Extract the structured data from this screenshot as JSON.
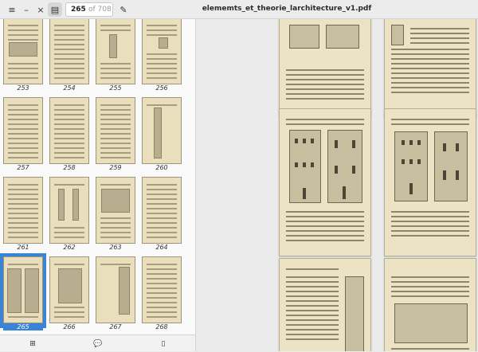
{
  "header": {
    "page_current": "265",
    "page_total": "of 708",
    "title": "elememts_et_theorie_larchitecture_v1.pdf"
  },
  "icons": {
    "menu": "≡",
    "minimize": "–",
    "close": "×",
    "sidebar": "▤",
    "edit": "✎",
    "thumbnails": "⊞",
    "annotations": "💬",
    "bookmarks": "▯"
  },
  "sidebar": {
    "thumbnails": [
      {
        "label": "253"
      },
      {
        "label": "254"
      },
      {
        "label": "255"
      },
      {
        "label": "256"
      },
      {
        "label": "257"
      },
      {
        "label": "258"
      },
      {
        "label": "259"
      },
      {
        "label": "260"
      },
      {
        "label": "261"
      },
      {
        "label": "262"
      },
      {
        "label": "263"
      },
      {
        "label": "264"
      },
      {
        "label": "265",
        "selected": true
      },
      {
        "label": "266"
      },
      {
        "label": "267"
      },
      {
        "label": "268"
      }
    ]
  },
  "colors": {
    "accent": "#3a84d6",
    "paper": "#ece2c4"
  }
}
